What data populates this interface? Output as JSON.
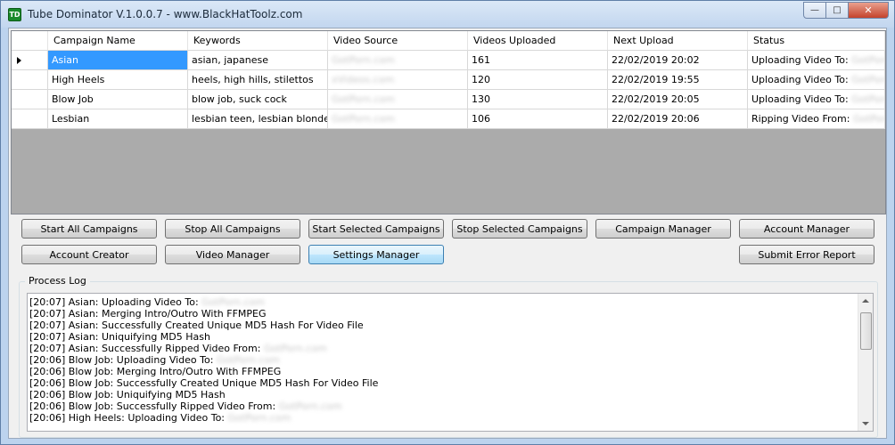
{
  "window": {
    "title": "Tube Dominator V.1.0.0.7 - www.BlackHatToolz.com",
    "icon_text": "TD"
  },
  "grid": {
    "columns": [
      "Campaign Name",
      "Keywords",
      "Video Source",
      "Videos Uploaded",
      "Next Upload",
      "Status"
    ],
    "rows": [
      {
        "name": "Asian",
        "keywords": "asian, japanese",
        "source": "GotPorn.com",
        "uploaded": "161",
        "next": "22/02/2019 20:02",
        "status_prefix": "Uploading Video To:",
        "status_site": "GotPorn.com"
      },
      {
        "name": "High Heels",
        "keywords": "heels, high hills, stilettos",
        "source": "xVideos.com",
        "uploaded": "120",
        "next": "22/02/2019 19:55",
        "status_prefix": "Uploading Video To:",
        "status_site": "GotPorn.com"
      },
      {
        "name": "Blow Job",
        "keywords": "blow job, suck cock",
        "source": "GotPorn.com",
        "uploaded": "130",
        "next": "22/02/2019 20:05",
        "status_prefix": "Uploading Video To:",
        "status_site": "GotPorn.com"
      },
      {
        "name": "Lesbian",
        "keywords": "lesbian teen, lesbian blonde, l...",
        "source": "GotPorn.com",
        "uploaded": "106",
        "next": "22/02/2019 20:06",
        "status_prefix": "Ripping Video From:",
        "status_site": "GotPorn.com"
      }
    ]
  },
  "buttons": {
    "start_all": "Start All Campaigns",
    "stop_all": "Stop All Campaigns",
    "start_selected": "Start Selected Campaigns",
    "stop_selected": "Stop Selected Campaigns",
    "campaign_manager": "Campaign Manager",
    "account_manager": "Account Manager",
    "account_creator": "Account Creator",
    "video_manager": "Video Manager",
    "settings_manager": "Settings Manager",
    "submit_error": "Submit Error Report"
  },
  "log": {
    "label": "Process Log",
    "lines": [
      {
        "text": "[20:07] Asian: Uploading Video To:",
        "site": "GotPorn.com"
      },
      {
        "text": "[20:07] Asian: Merging Intro/Outro With FFMPEG",
        "site": ""
      },
      {
        "text": "[20:07] Asian: Successfully Created Unique MD5 Hash For Video File",
        "site": ""
      },
      {
        "text": "[20:07] Asian: Uniquifying MD5 Hash",
        "site": ""
      },
      {
        "text": "[20:07] Asian: Successfully Ripped Video From:",
        "site": "GotPorn.com"
      },
      {
        "text": "[20:06] Blow Job: Uploading Video To:",
        "site": "GotPorn.com"
      },
      {
        "text": "[20:06] Blow Job: Merging Intro/Outro With FFMPEG",
        "site": ""
      },
      {
        "text": "[20:06] Blow Job: Successfully Created Unique MD5 Hash For Video File",
        "site": ""
      },
      {
        "text": "[20:06] Blow Job: Uniquifying MD5 Hash",
        "site": ""
      },
      {
        "text": "[20:06] Blow Job: Successfully Ripped Video From:",
        "site": "GotPorn.com"
      },
      {
        "text": "[20:06] High Heels: Uploading Video To:",
        "site": "GotPorn.com"
      }
    ]
  },
  "colors": {
    "selection": "#3399ff",
    "grid_background": "#ababab"
  }
}
